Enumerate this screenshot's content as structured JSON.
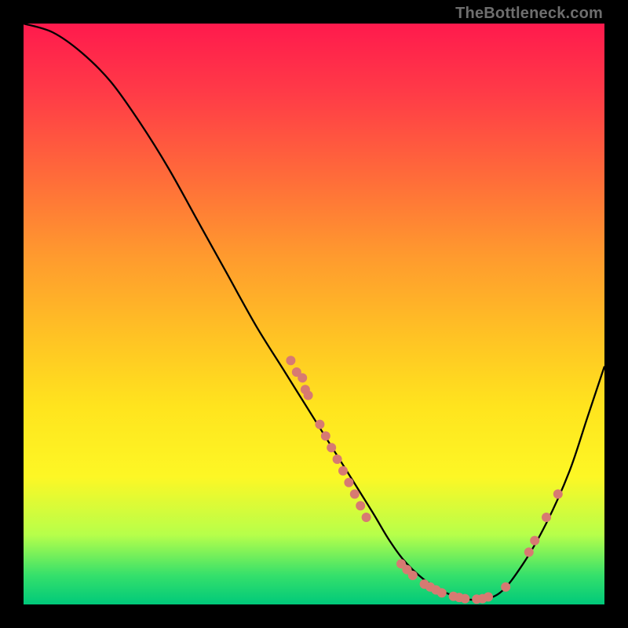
{
  "watermark": "TheBottleneck.com",
  "chart_data": {
    "type": "line",
    "title": "",
    "xlabel": "",
    "ylabel": "",
    "xlim": [
      0,
      100
    ],
    "ylim": [
      0,
      100
    ],
    "grid": false,
    "series": [
      {
        "name": "bottleneck-curve",
        "x": [
          0,
          5,
          10,
          15,
          20,
          25,
          30,
          35,
          40,
          45,
          50,
          55,
          60,
          63,
          66,
          70,
          74,
          78,
          82,
          86,
          90,
          94,
          97,
          100
        ],
        "y": [
          100,
          98.5,
          95,
          90,
          83,
          75,
          66,
          57,
          48,
          40,
          32,
          24,
          16,
          11,
          7,
          3.5,
          1.5,
          0.8,
          2,
          7,
          14,
          23,
          32,
          41
        ]
      }
    ],
    "points": [
      {
        "x": 46,
        "y": 42
      },
      {
        "x": 47,
        "y": 40
      },
      {
        "x": 48,
        "y": 39
      },
      {
        "x": 48.5,
        "y": 37
      },
      {
        "x": 49,
        "y": 36
      },
      {
        "x": 51,
        "y": 31
      },
      {
        "x": 52,
        "y": 29
      },
      {
        "x": 53,
        "y": 27
      },
      {
        "x": 54,
        "y": 25
      },
      {
        "x": 55,
        "y": 23
      },
      {
        "x": 56,
        "y": 21
      },
      {
        "x": 57,
        "y": 19
      },
      {
        "x": 58,
        "y": 17
      },
      {
        "x": 59,
        "y": 15
      },
      {
        "x": 65,
        "y": 7
      },
      {
        "x": 66,
        "y": 6
      },
      {
        "x": 67,
        "y": 5
      },
      {
        "x": 69,
        "y": 3.5
      },
      {
        "x": 70,
        "y": 3
      },
      {
        "x": 71,
        "y": 2.5
      },
      {
        "x": 72,
        "y": 2
      },
      {
        "x": 74,
        "y": 1.4
      },
      {
        "x": 75,
        "y": 1.2
      },
      {
        "x": 76,
        "y": 1
      },
      {
        "x": 78,
        "y": 0.9
      },
      {
        "x": 79,
        "y": 1
      },
      {
        "x": 80,
        "y": 1.3
      },
      {
        "x": 83,
        "y": 3
      },
      {
        "x": 87,
        "y": 9
      },
      {
        "x": 88,
        "y": 11
      },
      {
        "x": 90,
        "y": 15
      },
      {
        "x": 92,
        "y": 19
      }
    ],
    "point_radius": 6,
    "colors": {
      "line": "#000000",
      "points": "#d77a72"
    }
  }
}
